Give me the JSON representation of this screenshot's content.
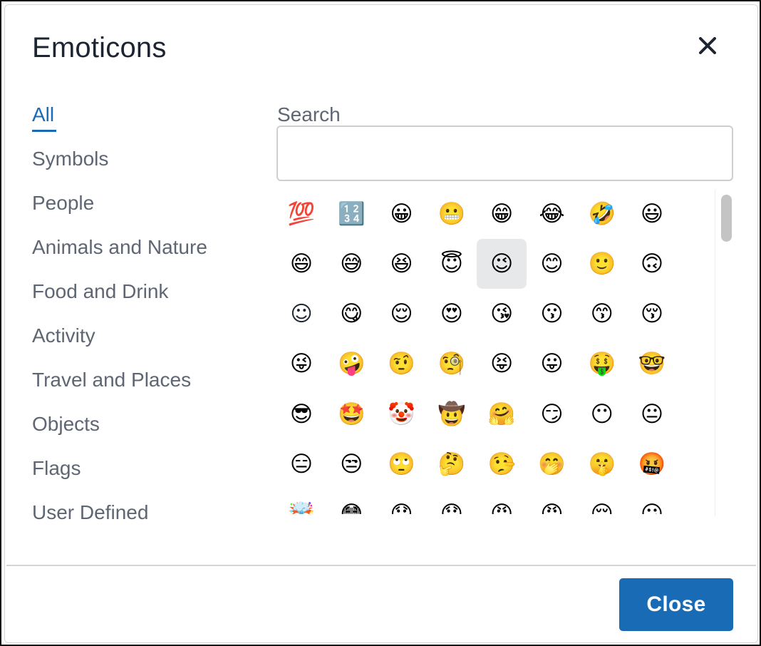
{
  "dialog": {
    "title": "Emoticons",
    "close_icon": "close-x-icon",
    "close_button_label": "Close"
  },
  "colors": {
    "accent": "#1a6bb5",
    "title_text": "#1d2533",
    "muted_text": "#5f6673",
    "hover_bg": "#e7e8ea",
    "scroll_thumb": "#c4c4c4"
  },
  "nav": {
    "active_index": 0,
    "items": [
      {
        "label": "All"
      },
      {
        "label": "Symbols"
      },
      {
        "label": "People"
      },
      {
        "label": "Animals and Nature"
      },
      {
        "label": "Food and Drink"
      },
      {
        "label": "Activity"
      },
      {
        "label": "Travel and Places"
      },
      {
        "label": "Objects"
      },
      {
        "label": "Flags"
      },
      {
        "label": "User Defined"
      }
    ]
  },
  "search": {
    "label": "Search",
    "value": "",
    "placeholder": ""
  },
  "emoji_grid": {
    "columns": 8,
    "hovered_index": 12,
    "emojis": [
      {
        "char": "💯",
        "name": "hundred-points"
      },
      {
        "char": "🔢",
        "name": "input-numbers"
      },
      {
        "char": "😀",
        "name": "grinning-face"
      },
      {
        "char": "😬",
        "name": "grimacing-face"
      },
      {
        "char": "😁",
        "name": "beaming-face"
      },
      {
        "char": "😂",
        "name": "face-with-tears-of-joy"
      },
      {
        "char": "🤣",
        "name": "rolling-on-floor-laughing"
      },
      {
        "char": "😃",
        "name": "grinning-face-big-eyes"
      },
      {
        "char": "😄",
        "name": "grinning-face-smiling-eyes"
      },
      {
        "char": "😅",
        "name": "grinning-face-with-sweat"
      },
      {
        "char": "😆",
        "name": "grinning-squinting-face"
      },
      {
        "char": "😇",
        "name": "smiling-face-with-halo"
      },
      {
        "char": "😉",
        "name": "winking-face"
      },
      {
        "char": "😊",
        "name": "smiling-face-smiling-eyes"
      },
      {
        "char": "🙂",
        "name": "slightly-smiling-face"
      },
      {
        "char": "🙃",
        "name": "upside-down-face"
      },
      {
        "char": "☺",
        "name": "smiling-face-outline",
        "mono": true
      },
      {
        "char": "😋",
        "name": "face-savoring-food"
      },
      {
        "char": "😌",
        "name": "relieved-face"
      },
      {
        "char": "😍",
        "name": "heart-eyes"
      },
      {
        "char": "😘",
        "name": "face-blowing-kiss"
      },
      {
        "char": "😗",
        "name": "kissing-face"
      },
      {
        "char": "😙",
        "name": "kissing-face-smiling-eyes"
      },
      {
        "char": "😚",
        "name": "kissing-face-closed-eyes"
      },
      {
        "char": "😜",
        "name": "winking-face-with-tongue"
      },
      {
        "char": "🤪",
        "name": "zany-face"
      },
      {
        "char": "🤨",
        "name": "raised-eyebrow"
      },
      {
        "char": "🧐",
        "name": "face-with-monocle"
      },
      {
        "char": "😝",
        "name": "squinting-face-with-tongue"
      },
      {
        "char": "😛",
        "name": "face-with-tongue"
      },
      {
        "char": "🤑",
        "name": "money-mouth-face"
      },
      {
        "char": "🤓",
        "name": "nerd-face"
      },
      {
        "char": "😎",
        "name": "smiling-face-with-sunglasses"
      },
      {
        "char": "🤩",
        "name": "star-struck"
      },
      {
        "char": "🤡",
        "name": "clown-face"
      },
      {
        "char": "🤠",
        "name": "cowboy-hat-face"
      },
      {
        "char": "🤗",
        "name": "hugging-face"
      },
      {
        "char": "😏",
        "name": "smirking-face"
      },
      {
        "char": "😶",
        "name": "face-without-mouth"
      },
      {
        "char": "😐",
        "name": "neutral-face"
      },
      {
        "char": "😑",
        "name": "expressionless-face"
      },
      {
        "char": "😒",
        "name": "unamused-face"
      },
      {
        "char": "🙄",
        "name": "face-with-rolling-eyes"
      },
      {
        "char": "🤔",
        "name": "thinking-face"
      },
      {
        "char": "🤥",
        "name": "lying-face"
      },
      {
        "char": "🤭",
        "name": "face-with-hand-over-mouth"
      },
      {
        "char": "🤫",
        "name": "shushing-face"
      },
      {
        "char": "🤬",
        "name": "face-with-symbols-on-mouth"
      },
      {
        "char": "🤯",
        "name": "exploding-head"
      },
      {
        "char": "😳",
        "name": "flushed-face"
      },
      {
        "char": "😞",
        "name": "disappointed-face"
      },
      {
        "char": "😟",
        "name": "worried-face"
      },
      {
        "char": "😠",
        "name": "angry-face"
      },
      {
        "char": "😡",
        "name": "pouting-face"
      },
      {
        "char": "😔",
        "name": "pensive-face"
      },
      {
        "char": "😕",
        "name": "confused-face"
      }
    ]
  },
  "scrollbar": {
    "position_fraction": 0.0
  }
}
